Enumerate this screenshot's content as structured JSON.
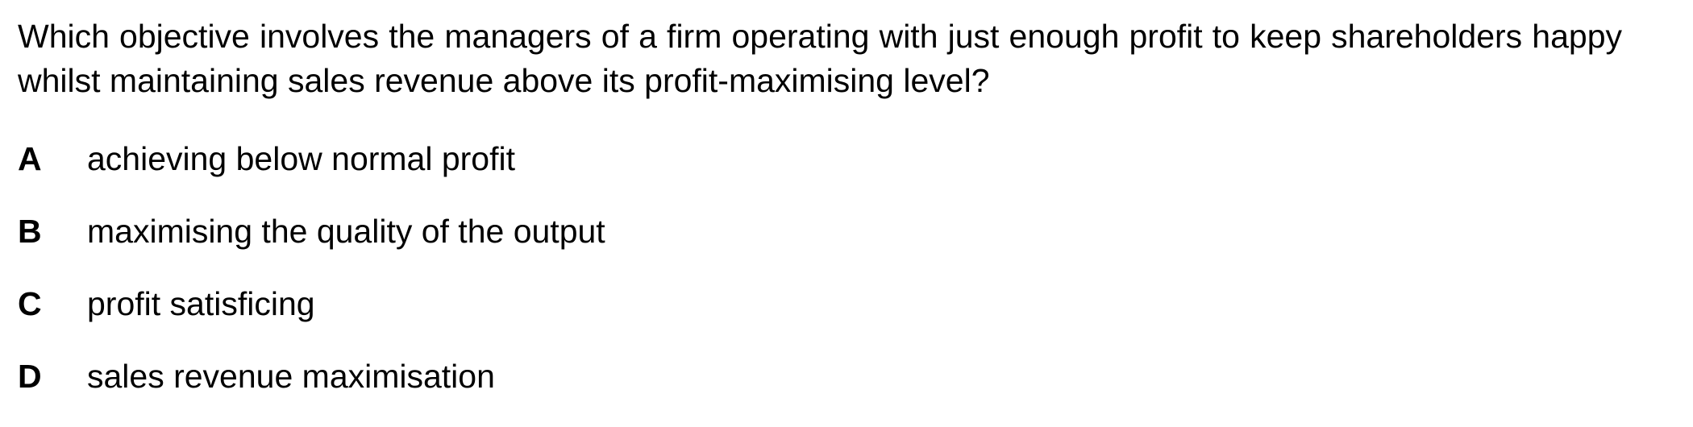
{
  "question": {
    "text": "Which objective involves the managers of a firm operating with just enough profit to keep shareholders happy whilst maintaining sales revenue above its profit-maximising level?"
  },
  "options": [
    {
      "letter": "A",
      "text": "achieving below normal profit"
    },
    {
      "letter": "B",
      "text": "maximising the quality of the output"
    },
    {
      "letter": "C",
      "text": "profit satisficing"
    },
    {
      "letter": "D",
      "text": "sales revenue maximisation"
    }
  ]
}
